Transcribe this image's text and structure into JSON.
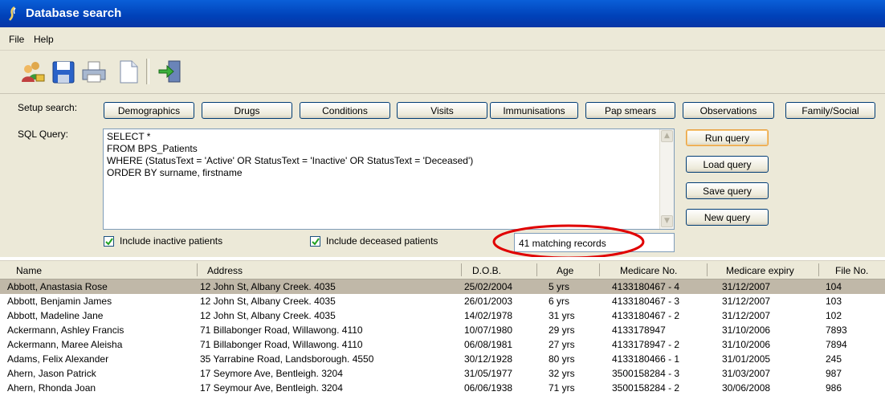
{
  "window": {
    "title": "Database search"
  },
  "menu": {
    "items": [
      "File",
      "Help"
    ]
  },
  "toolbar": {
    "icons": [
      "users-icon",
      "save-icon",
      "print-icon",
      "new-document-icon",
      "exit-icon"
    ]
  },
  "setup": {
    "label": "Setup search:",
    "buttons": [
      "Demographics",
      "Drugs",
      "Conditions",
      "Visits",
      "Immunisations",
      "Pap smears",
      "Observations",
      "Family/Social"
    ]
  },
  "sql": {
    "label": "SQL Query:",
    "lines": [
      "SELECT *",
      "FROM BPS_Patients",
      "WHERE (StatusText = 'Active' OR StatusText = 'Inactive' OR StatusText = 'Deceased')",
      "ORDER BY surname, firstname"
    ]
  },
  "actions": {
    "run": "Run query",
    "load": "Load query",
    "save": "Save query",
    "new": "New query"
  },
  "options": {
    "inactive": {
      "label": "Include inactive patients",
      "checked": true
    },
    "deceased": {
      "label": "Include deceased patients",
      "checked": true
    }
  },
  "status": {
    "count_text": "41 matching records",
    "highlight_color": "#e00000"
  },
  "grid": {
    "columns": [
      "Name",
      "Address",
      "D.O.B.",
      "Age",
      "Medicare No.",
      "Medicare expiry",
      "File No."
    ],
    "rows": [
      [
        "Abbott, Anastasia Rose",
        "12 John St, Albany Creek. 4035",
        "25/02/2004",
        "5 yrs",
        "4133180467 - 4",
        "31/12/2007",
        "104"
      ],
      [
        "Abbott, Benjamin James",
        "12 John St, Albany Creek. 4035",
        "26/01/2003",
        "6 yrs",
        "4133180467 - 3",
        "31/12/2007",
        "103"
      ],
      [
        "Abbott, Madeline Jane",
        "12 John St, Albany Creek. 4035",
        "14/02/1978",
        "31 yrs",
        "4133180467 - 2",
        "31/12/2007",
        "102"
      ],
      [
        "Ackermann, Ashley Francis",
        "71 Billabonger Road, Willawong. 4110",
        "10/07/1980",
        "29 yrs",
        "4133178947",
        "31/10/2006",
        "7893"
      ],
      [
        "Ackermann, Maree Aleisha",
        "71 Billabonger Road, Willawong. 4110",
        "06/08/1981",
        "27 yrs",
        "4133178947 - 2",
        "31/10/2006",
        "7894"
      ],
      [
        "Adams, Felix Alexander",
        "35 Yarrabine Road, Landsborough. 4550",
        "30/12/1928",
        "80 yrs",
        "4133180466 - 1",
        "31/01/2005",
        "245"
      ],
      [
        "Ahern, Jason Patrick",
        "17 Seymore Ave, Bentleigh. 3204",
        "31/05/1977",
        "32 yrs",
        "3500158284 - 3",
        "31/03/2007",
        "987"
      ],
      [
        "Ahern, Rhonda Joan",
        "17 Seymour Ave, Bentleigh. 3204",
        "06/06/1938",
        "71 yrs",
        "3500158284 - 2",
        "30/06/2008",
        "986"
      ]
    ],
    "selected_row": 0
  }
}
